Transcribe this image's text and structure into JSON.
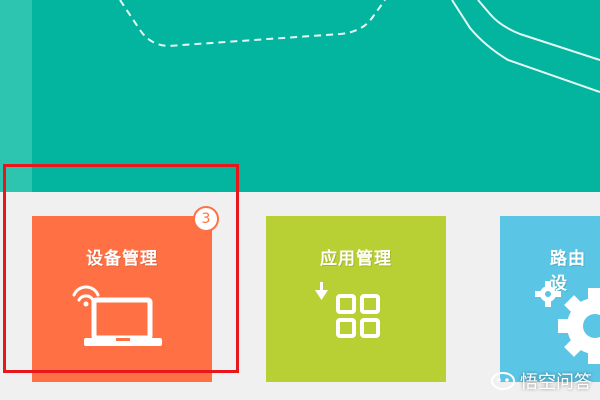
{
  "header": {
    "background_color": "#03b59f"
  },
  "tiles": [
    {
      "title": "设备管理",
      "color": "#ff7145",
      "icon": "laptop-wifi-icon",
      "badge": "3"
    },
    {
      "title": "应用管理",
      "color": "#b8d033",
      "icon": "app-grid-download-icon"
    },
    {
      "title": "路由设",
      "color": "#5bc5e5",
      "icon": "gear-icon"
    }
  ],
  "highlight": {
    "color": "#e8171c",
    "target": "设备管理"
  },
  "watermark": {
    "text": "悟空问答",
    "icon": "wukong-logo-icon"
  }
}
